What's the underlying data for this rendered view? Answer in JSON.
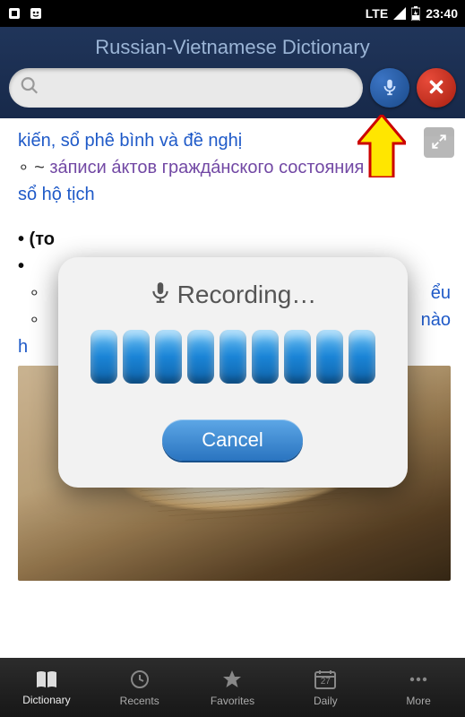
{
  "status": {
    "time": "23:40",
    "network": "LTE"
  },
  "header": {
    "title": "Russian-Vietnamese Dictionary",
    "search_placeholder": ""
  },
  "content": {
    "line1": "kiến, sổ phê bình và đề nghị",
    "line2_bullet": "∘ ~ ",
    "line2_ru": "зáписи áктов граждáнского состояния",
    "line3": "sổ hộ tịch",
    "header2": "• (то",
    "bullet_dot": "•",
    "frag_eu": "ểu",
    "frag_o": "∘",
    "frag_nao": "nào",
    "frag_h": "h"
  },
  "dialog": {
    "title": "Recording…",
    "cancel_label": "Cancel"
  },
  "nav": {
    "items": [
      {
        "label": "Dictionary"
      },
      {
        "label": "Recents"
      },
      {
        "label": "Favorites"
      },
      {
        "label": "Daily",
        "day": "27"
      },
      {
        "label": "More"
      }
    ]
  }
}
